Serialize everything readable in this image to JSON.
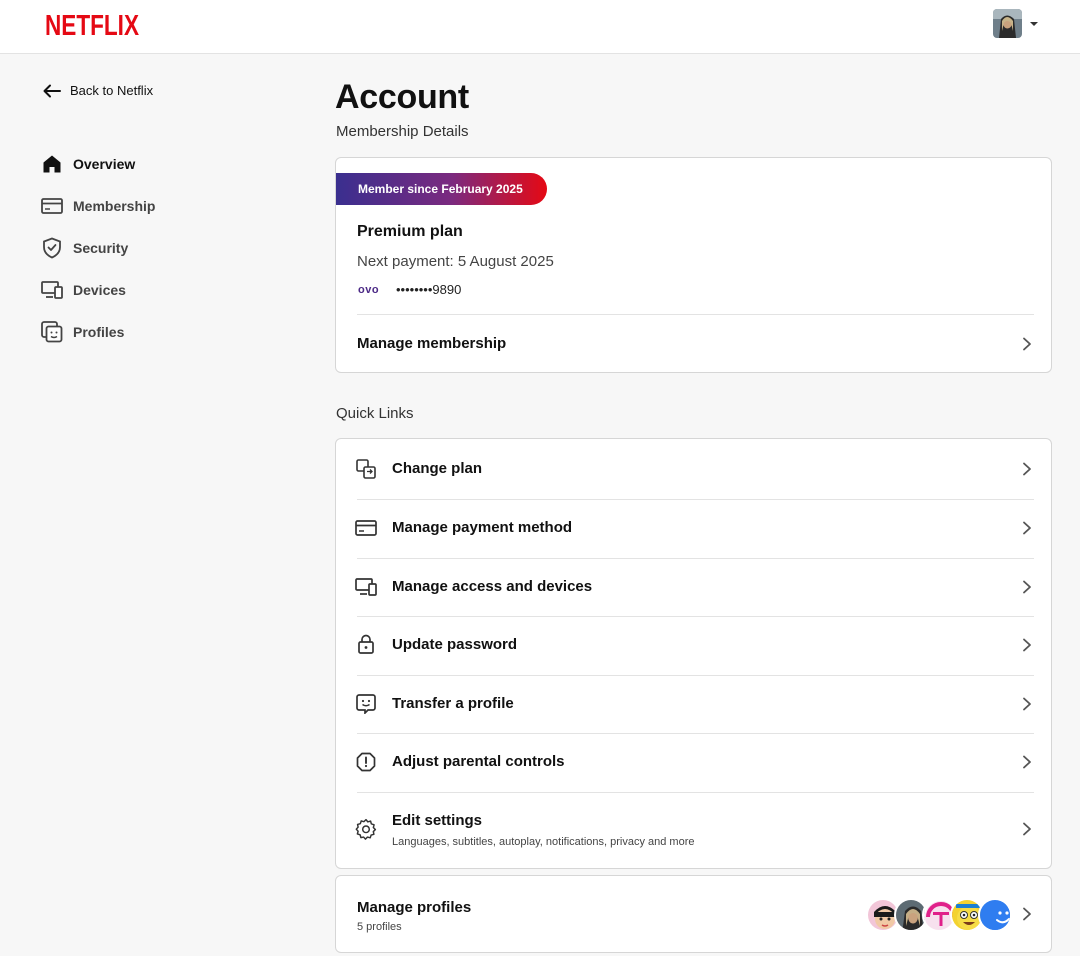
{
  "header": {
    "logo_text": "NETFLIX",
    "brand_color": "#e50914"
  },
  "sidebar": {
    "back_label": "Back to Netflix",
    "items": [
      {
        "label": "Overview",
        "icon": "home-icon",
        "active": true
      },
      {
        "label": "Membership",
        "icon": "card-icon",
        "active": false
      },
      {
        "label": "Security",
        "icon": "shield-icon",
        "active": false
      },
      {
        "label": "Devices",
        "icon": "devices-icon",
        "active": false
      },
      {
        "label": "Profiles",
        "icon": "profiles-icon",
        "active": false
      }
    ]
  },
  "main": {
    "title": "Account",
    "subtitle": "Membership Details",
    "membership": {
      "badge": "Member since February 2025",
      "plan": "Premium plan",
      "next_payment": "Next payment: 5 August 2025",
      "payment_brand": "OVO",
      "masked_number": "••••••••9890",
      "manage_label": "Manage membership"
    },
    "quick_links_label": "Quick Links",
    "quick_links": [
      {
        "label": "Change plan",
        "icon": "change-plan-icon"
      },
      {
        "label": "Manage payment method",
        "icon": "credit-card-icon"
      },
      {
        "label": "Manage access and devices",
        "icon": "devices-icon"
      },
      {
        "label": "Update password",
        "icon": "lock-icon"
      },
      {
        "label": "Transfer a profile",
        "icon": "transfer-profile-icon"
      },
      {
        "label": "Adjust parental controls",
        "icon": "alert-octagon-icon"
      },
      {
        "label": "Edit settings",
        "icon": "gear-icon",
        "description": "Languages, subtitles, autoplay, notifications, privacy and more"
      }
    ],
    "manage_profiles": {
      "title": "Manage profiles",
      "subtitle": "5 profiles",
      "avatar_icons": [
        "profile-avatar-1",
        "profile-avatar-2",
        "profile-avatar-3",
        "profile-avatar-4",
        "profile-avatar-5"
      ]
    }
  }
}
